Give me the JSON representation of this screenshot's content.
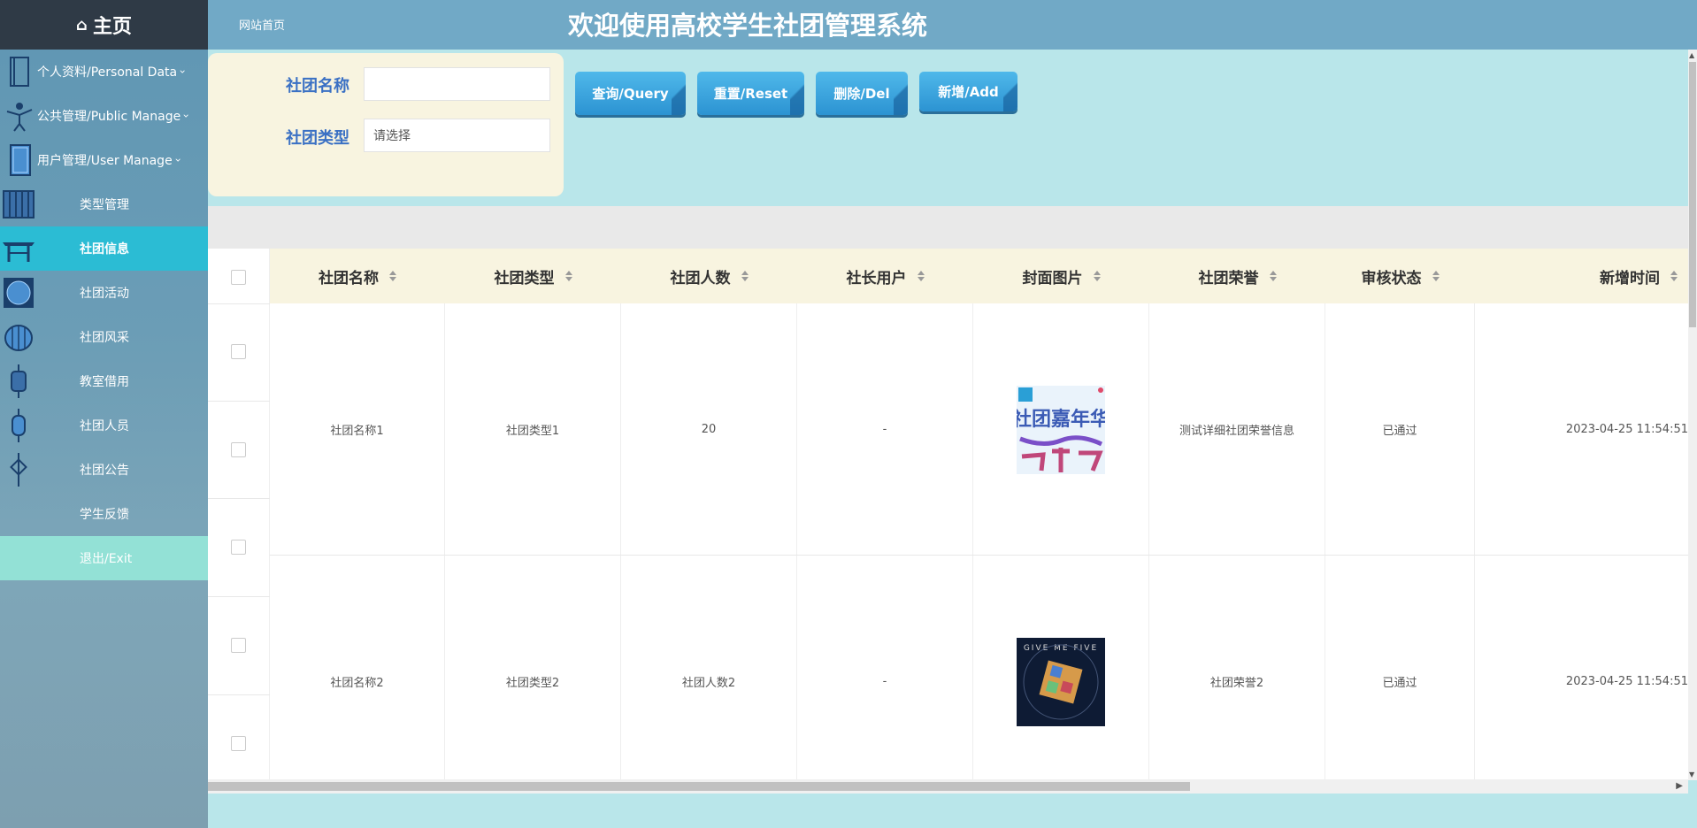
{
  "sidebar": {
    "home": "主页",
    "groups": [
      {
        "label": "个人资料/Personal Data"
      },
      {
        "label": "公共管理/Public Manage"
      },
      {
        "label": "用户管理/User Manage"
      }
    ],
    "items": [
      {
        "label": "类型管理"
      },
      {
        "label": "社团信息"
      },
      {
        "label": "社团活动"
      },
      {
        "label": "社团风采"
      },
      {
        "label": "教室借用"
      },
      {
        "label": "社团人员"
      },
      {
        "label": "社团公告"
      },
      {
        "label": "学生反馈"
      },
      {
        "label": "退出/Exit"
      }
    ]
  },
  "header": {
    "breadcrumb": "网站首页",
    "title": "欢迎使用高校学生社团管理系统"
  },
  "search": {
    "name_label": "社团名称",
    "name_value": "",
    "type_label": "社团类型",
    "type_value": "请选择"
  },
  "toolbar": {
    "query": "查询/Query",
    "reset": "重置/Reset",
    "delete": "删除/Del",
    "add": "新增/Add"
  },
  "table": {
    "columns": [
      "社团名称",
      "社团类型",
      "社团人数",
      "社长用户",
      "封面图片",
      "社团荣誉",
      "审核状态",
      "新增时间"
    ],
    "rows": [
      {
        "name": "社团名称1",
        "type": "社团类型1",
        "count": "20",
        "leader": "-",
        "cover": "社团嘉年华",
        "honor": "测试详细社团荣誉信息",
        "status": "已通过",
        "time": "2023-04-25 11:54:51"
      },
      {
        "name": "社团名称2",
        "type": "社团类型2",
        "count": "社团人数2",
        "leader": "-",
        "cover": "GIVE ME FIVE",
        "honor": "社团荣誉2",
        "status": "已通过",
        "time": "2023-04-25 11:54:51"
      }
    ]
  },
  "colors": {
    "sidebar_active": "#2bbcd4",
    "header": "#71a9c6",
    "button": "#2c93d2",
    "label_blue": "#3a70c4"
  }
}
